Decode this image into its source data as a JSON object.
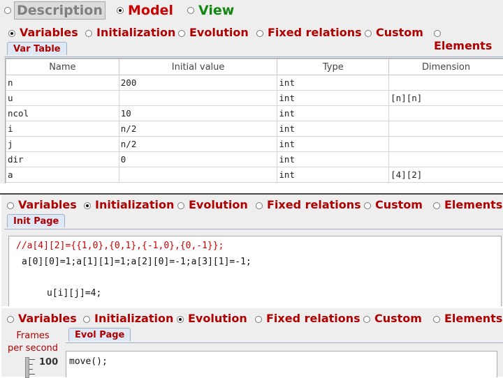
{
  "top_tabs": [
    {
      "label": "Description",
      "selected": false
    },
    {
      "label": "Model",
      "selected": true
    },
    {
      "label": "View",
      "selected": false
    }
  ],
  "panel1": {
    "subtabs": [
      {
        "label": "Variables",
        "selected": true
      },
      {
        "label": "Initialization",
        "selected": false
      },
      {
        "label": "Evolution",
        "selected": false
      },
      {
        "label": "Fixed relations",
        "selected": false
      },
      {
        "label": "Custom",
        "selected": false
      },
      {
        "label": "Elements",
        "selected": false
      }
    ],
    "page_tab": "Var Table",
    "columns": [
      "Name",
      "Initial value",
      "Type",
      "Dimension"
    ],
    "rows": [
      [
        "n",
        "200",
        "int",
        ""
      ],
      [
        "u",
        "",
        "int",
        "[n][n]"
      ],
      [
        "ncol",
        "10",
        "int",
        ""
      ],
      [
        "i",
        "n/2",
        "int",
        ""
      ],
      [
        "j",
        "n/2",
        "int",
        ""
      ],
      [
        "dir",
        "0",
        "int",
        ""
      ],
      [
        "a",
        "",
        "int",
        "[4][2]"
      ]
    ]
  },
  "panel2": {
    "subtabs": [
      {
        "label": "Variables",
        "selected": false
      },
      {
        "label": "Initialization",
        "selected": true
      },
      {
        "label": "Evolution",
        "selected": false
      },
      {
        "label": "Fixed relations",
        "selected": false
      },
      {
        "label": "Custom",
        "selected": false
      },
      {
        "label": "Elements",
        "selected": false
      }
    ],
    "page_tab": "Init Page",
    "code": {
      "comment": "//a[4][2]={{1,0},{0,1},{-1,0},{0,-1}};",
      "line2": "a[0][0]=1;a[1][1]=1;a[2][0]=-1;a[3][1]=-1;",
      "line3": "u[i][j]=4;"
    }
  },
  "panel3": {
    "subtabs": [
      {
        "label": "Variables",
        "selected": false
      },
      {
        "label": "Initialization",
        "selected": false
      },
      {
        "label": "Evolution",
        "selected": true
      },
      {
        "label": "Fixed relations",
        "selected": false
      },
      {
        "label": "Custom",
        "selected": false
      },
      {
        "label": "Elements",
        "selected": false
      }
    ],
    "page_tab": "Evol Page",
    "fps_label_1": "Frames",
    "fps_label_2": "per second",
    "fps_value": "100",
    "code": "move();"
  }
}
